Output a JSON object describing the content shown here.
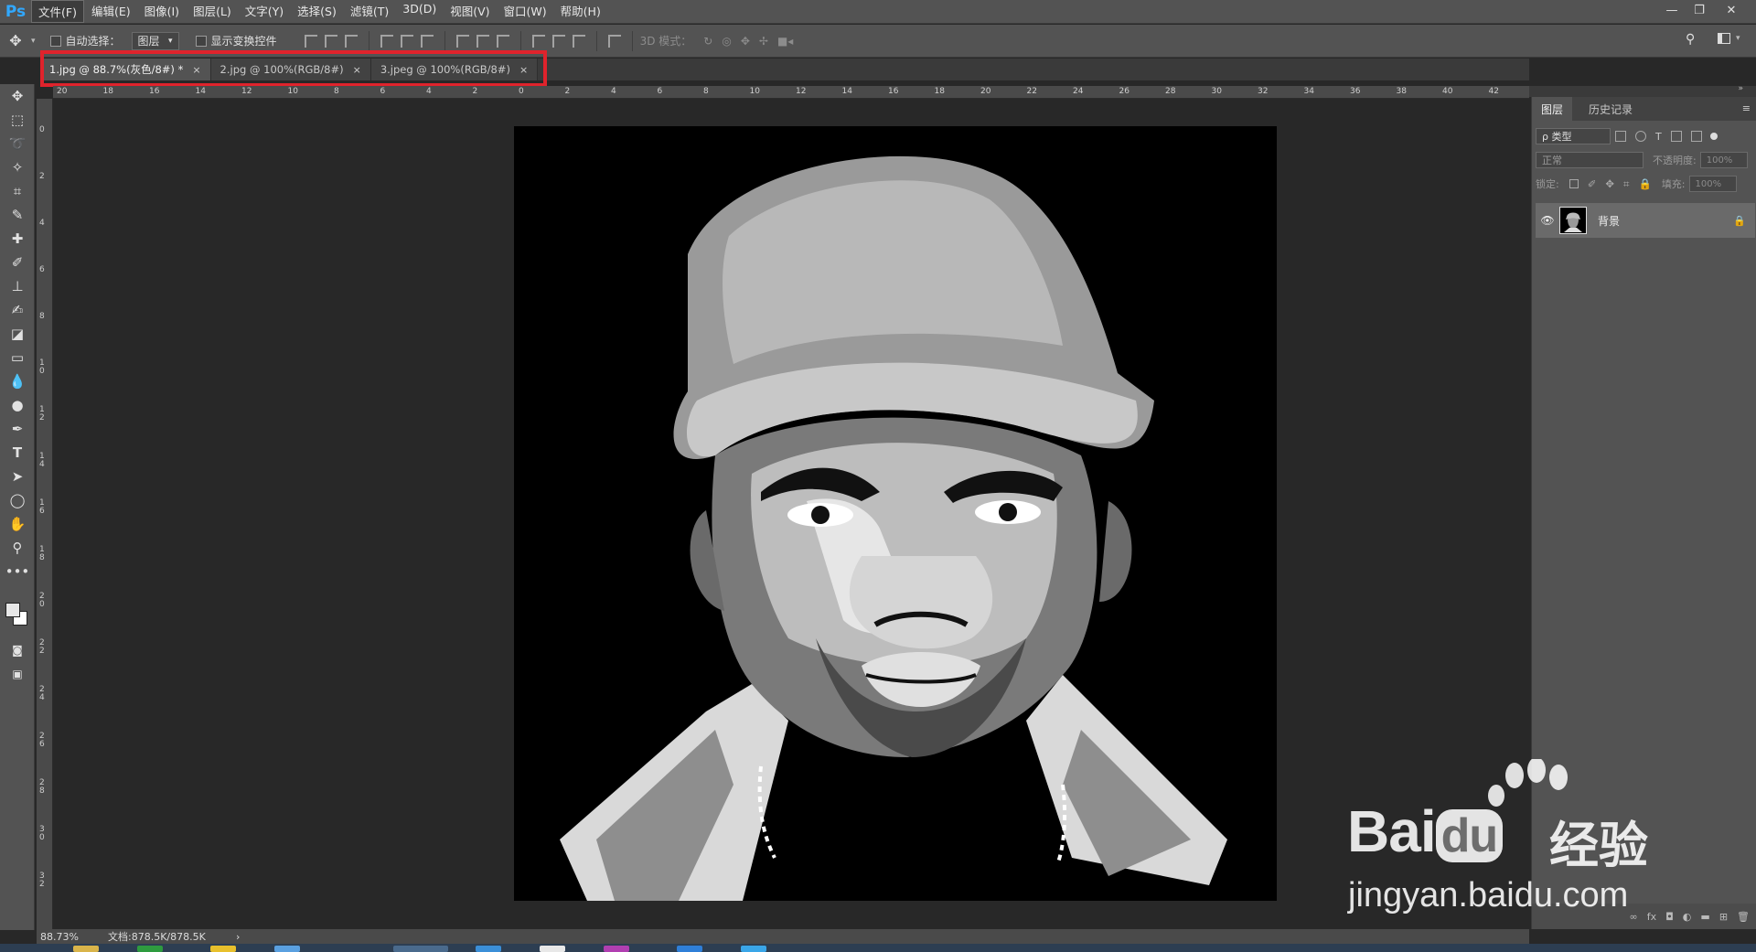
{
  "app": {
    "logo": "Ps"
  },
  "menu": [
    "文件(F)",
    "编辑(E)",
    "图像(I)",
    "图层(L)",
    "文字(Y)",
    "选择(S)",
    "滤镜(T)",
    "3D(D)",
    "视图(V)",
    "窗口(W)",
    "帮助(H)"
  ],
  "window_controls": {
    "minimize": "—",
    "restore": "❐",
    "close": "✕"
  },
  "options": {
    "auto_select_label": "自动选择：",
    "auto_select_target": "图层",
    "show_transform_label": "显示变换控件",
    "mode_3d_label": "3D 模式："
  },
  "tabs": [
    {
      "label": "1.jpg @ 88.7%(灰色/8#) *",
      "close": "×"
    },
    {
      "label": "2.jpg @ 100%(RGB/8#)",
      "close": "×"
    },
    {
      "label": "3.jpeg @ 100%(RGB/8#)",
      "close": "×"
    }
  ],
  "ruler_top": [
    "20",
    "18",
    "16",
    "14",
    "12",
    "10",
    "8",
    "6",
    "4",
    "2",
    "0",
    "2",
    "4",
    "6",
    "8",
    "10",
    "12",
    "14",
    "16",
    "18",
    "20",
    "22",
    "24",
    "26",
    "28",
    "30",
    "32",
    "34",
    "36",
    "38",
    "40",
    "42"
  ],
  "ruler_left": [
    "0",
    "2",
    "4",
    "6",
    "8",
    "10",
    "12",
    "14",
    "16",
    "18",
    "20",
    "22",
    "24",
    "26",
    "28",
    "30",
    "32"
  ],
  "status": {
    "zoom": "88.73%",
    "doc": "文档:878.5K/878.5K",
    "arrow": "›"
  },
  "panel": {
    "tab_layers": "图层",
    "tab_history": "历史记录",
    "filter_label": "ρ 类型",
    "blend_mode": "正常",
    "opacity_label": "不透明度:",
    "opacity_value": "100%",
    "lock_label": "锁定:",
    "fill_label": "填充:",
    "fill_value": "100%",
    "layer_name": "背景"
  },
  "watermark": {
    "brand": "Bai",
    "brand2": "du",
    "cn": "经验",
    "url": "jingyan.baidu.com"
  },
  "colors": {
    "accent_ps": "#31a8ff",
    "highlight": "#e0232c",
    "ui_bg": "#535353",
    "canvas_bg": "#282828"
  }
}
